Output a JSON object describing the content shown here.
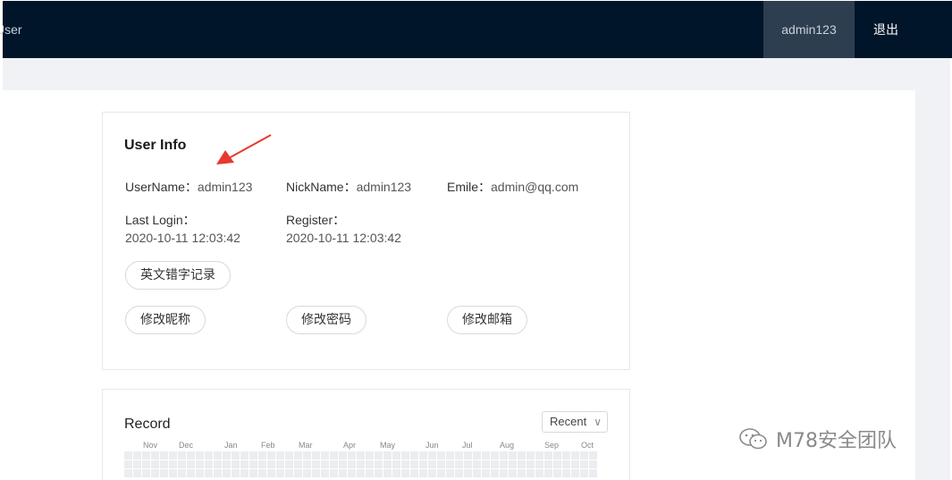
{
  "header": {
    "brand": "User",
    "username": "admin123",
    "logout": "退出"
  },
  "user_info": {
    "title": "User Info",
    "username_label": "UserName：",
    "username_value": "admin123",
    "nickname_label": "NickName：",
    "nickname_value": "admin123",
    "email_label": "Emile：",
    "email_value": "admin@qq.com",
    "last_login_label": "Last Login：",
    "last_login_value": "2020-10-11 12:03:42",
    "register_label": "Register：",
    "register_value": "2020-10-11 12:03:42",
    "buttons": {
      "typo_log": "英文错字记录",
      "edit_nickname": "修改昵称",
      "edit_password": "修改密码",
      "edit_email": "修改邮箱"
    }
  },
  "record": {
    "title": "Record",
    "range_select": "Recent",
    "months": [
      "Nov",
      "Dec",
      "Jan",
      "Feb",
      "Mar",
      "Apr",
      "May",
      "Jun",
      "Jul",
      "Aug",
      "Sep",
      "Oct"
    ]
  },
  "watermark": "M78安全团队",
  "annotation_color": "#e8382f"
}
